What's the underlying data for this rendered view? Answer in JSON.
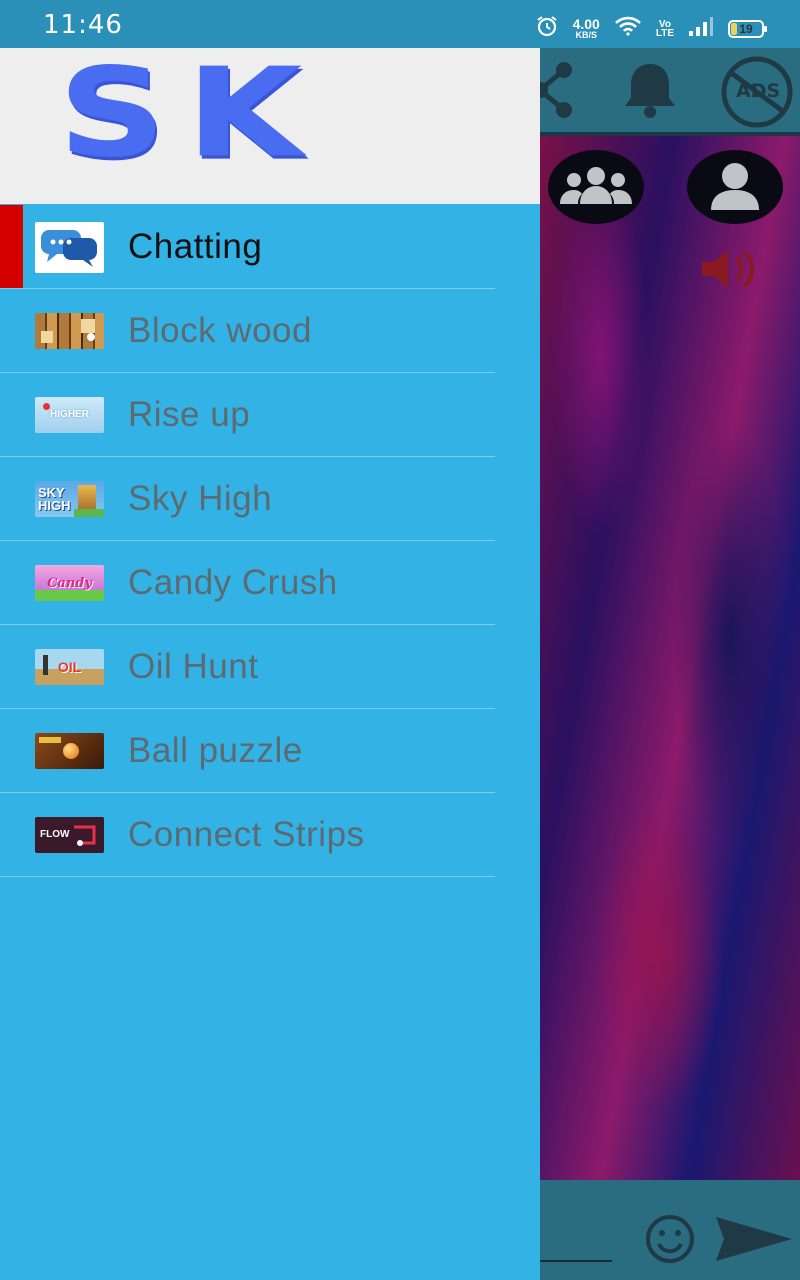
{
  "status_bar": {
    "time": "11:46",
    "speed_value": "4.00",
    "speed_unit": "KB/S",
    "volte_top": "Vo",
    "volte_bottom": "LTE",
    "battery_level": "19",
    "battery_fraction": 0.19
  },
  "drawer": {
    "logo": "SK",
    "items": [
      {
        "label": "Chatting",
        "icon": "chat-bubbles-icon",
        "active": true
      },
      {
        "label": "Block wood",
        "icon": "block-wood-thumbnail",
        "active": false
      },
      {
        "label": "Rise up",
        "icon": "rise-up-thumbnail",
        "thumb_text": "HIGHER",
        "active": false
      },
      {
        "label": "Sky High",
        "icon": "sky-high-thumbnail",
        "thumb_text_1": "SKY",
        "thumb_text_2": "HIGH",
        "active": false
      },
      {
        "label": "Candy Crush",
        "icon": "candy-crush-thumbnail",
        "thumb_text": "Candy",
        "active": false
      },
      {
        "label": "Oil Hunt",
        "icon": "oil-hunt-thumbnail",
        "thumb_text": "OIL",
        "active": false
      },
      {
        "label": "Ball puzzle",
        "icon": "ball-puzzle-thumbnail",
        "active": false
      },
      {
        "label": "Connect Strips",
        "icon": "connect-strips-thumbnail",
        "thumb_text": "FLOW",
        "active": false
      }
    ]
  },
  "background_app": {
    "toolbar_icons": [
      "share-icon",
      "bell-icon",
      "ads-icon"
    ],
    "ads_label": "ADS",
    "floating_icons": [
      "group-icon",
      "profile-icon",
      "speaker-icon"
    ],
    "bottom_icons": [
      "emoji-icon",
      "send-icon"
    ]
  },
  "colors": {
    "drawer": "#33b3e5",
    "status_bar": "#2a90b8",
    "active_indicator": "#d40000",
    "logo": "#4a6cf0"
  }
}
